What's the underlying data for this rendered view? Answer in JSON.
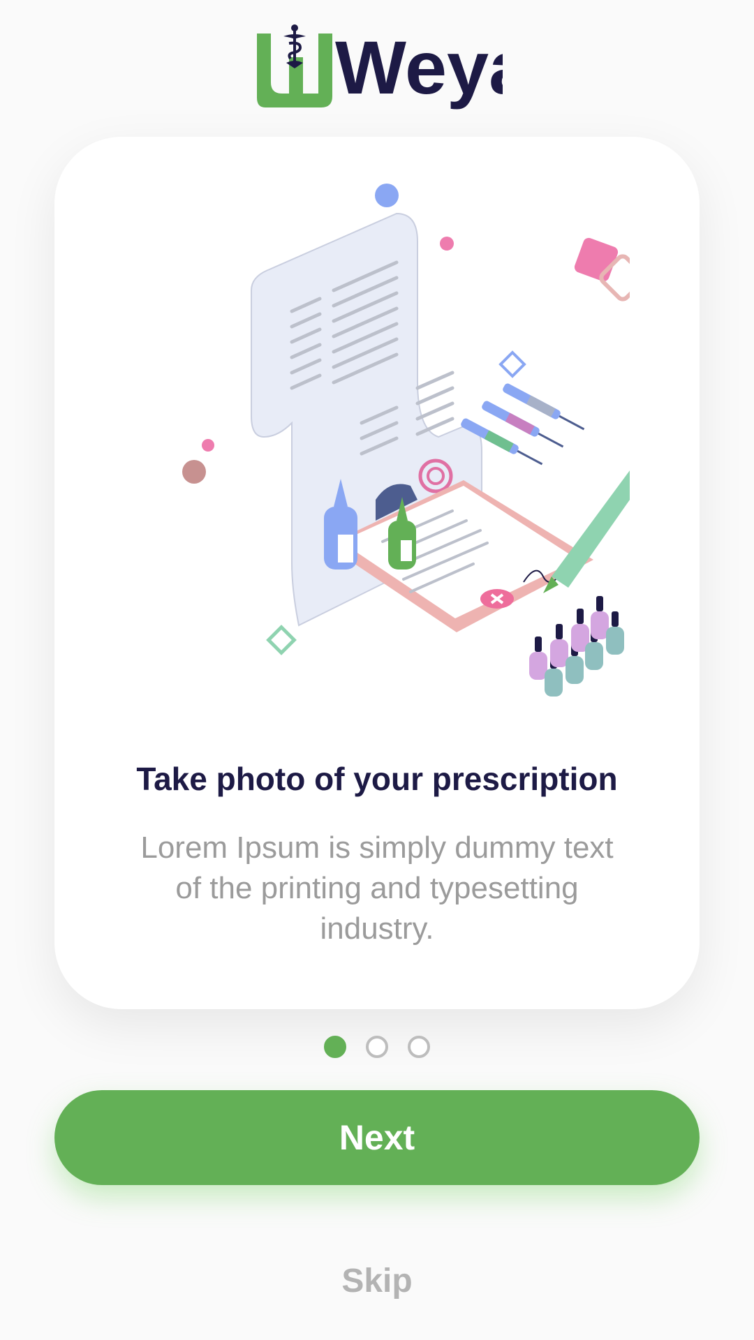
{
  "brand": {
    "name": "Weyak",
    "accent": "#63b056",
    "dark": "#1d1a45"
  },
  "slide": {
    "title": "Take photo of your prescription",
    "description": "Lorem Ipsum is simply dummy text of the printing and typesetting industry."
  },
  "pagination": {
    "current": 1,
    "total": 3
  },
  "actions": {
    "next_label": "Next",
    "skip_label": "Skip"
  },
  "icons": {
    "logo_symbol": "rod-of-asclepius-icon",
    "illustration": "prescription-illustration"
  }
}
